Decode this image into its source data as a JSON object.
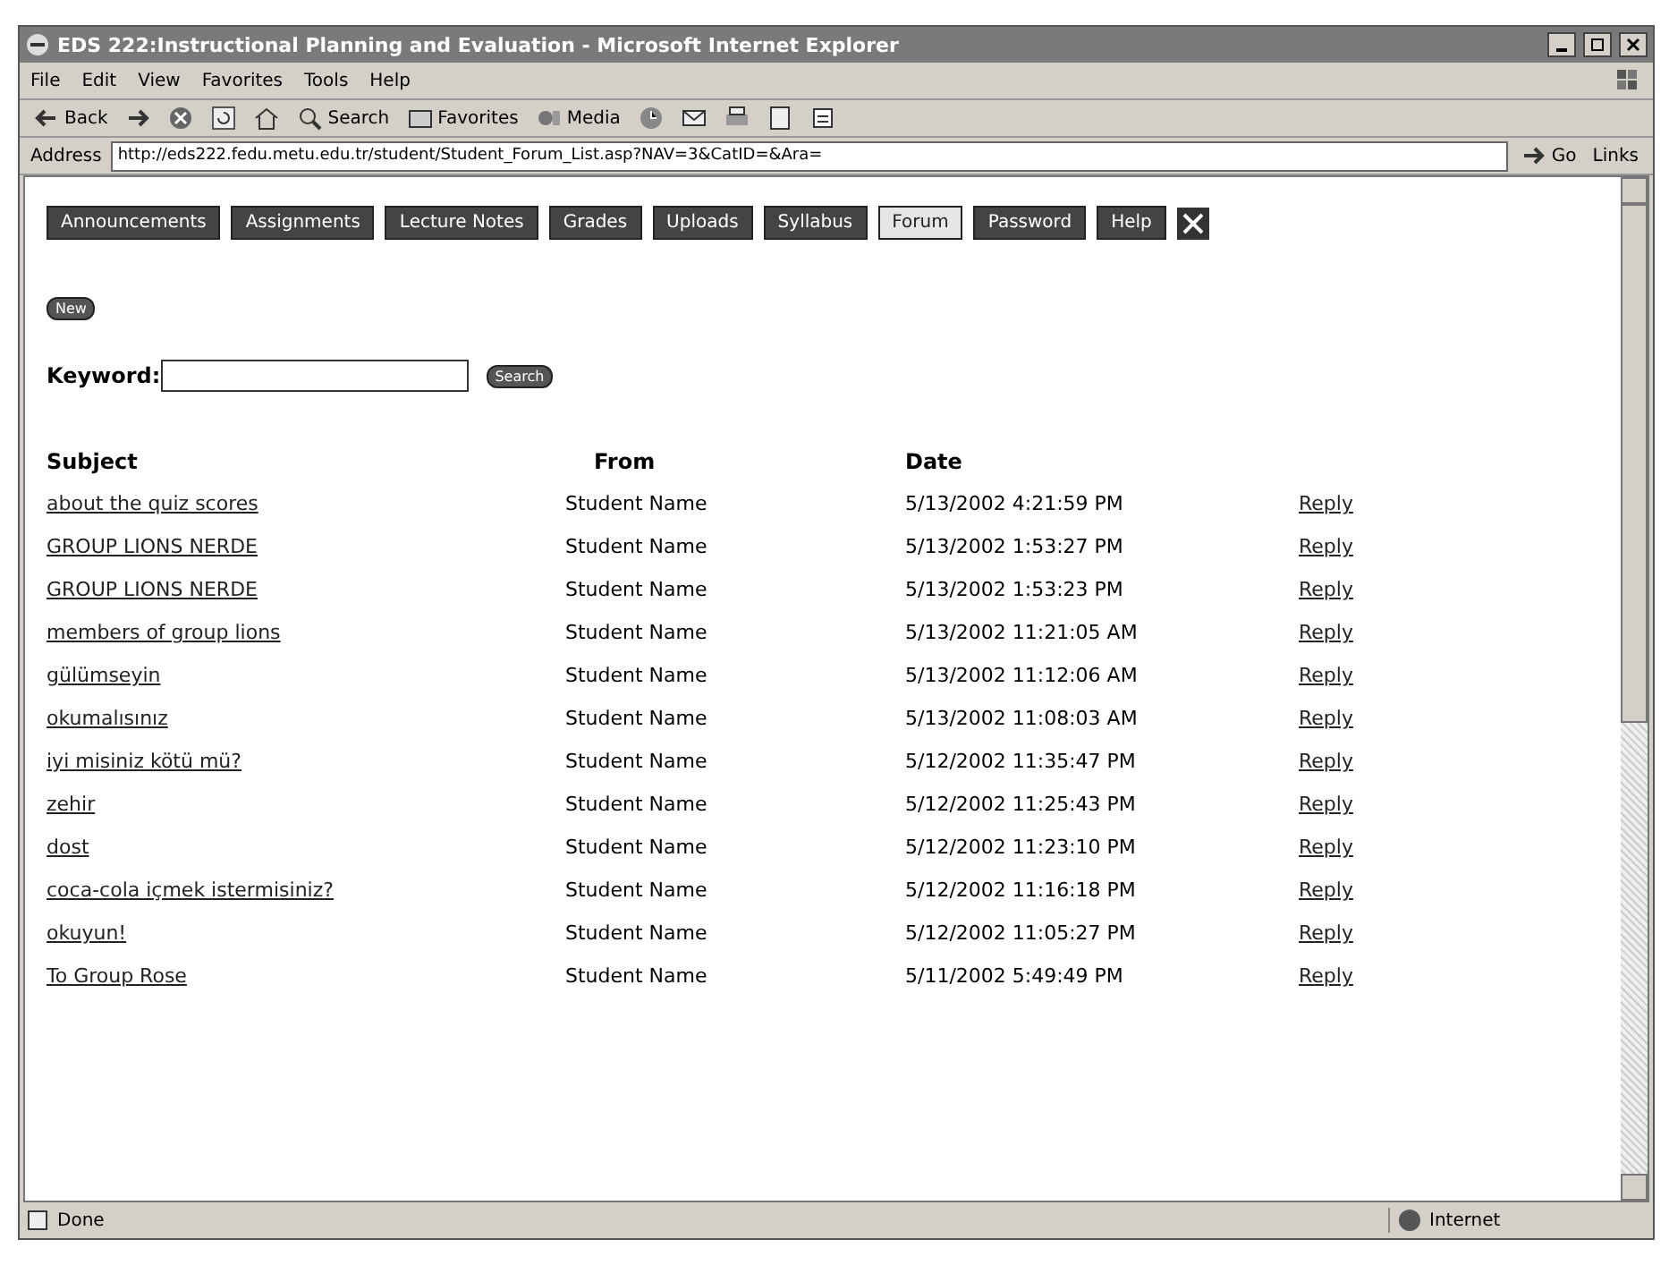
{
  "window": {
    "title": "EDS 222:Instructional Planning and Evaluation - Microsoft Internet Explorer"
  },
  "menu": [
    "File",
    "Edit",
    "View",
    "Favorites",
    "Tools",
    "Help"
  ],
  "toolbar": [
    {
      "kind": "back",
      "label": "Back"
    },
    {
      "kind": "forward"
    },
    {
      "kind": "stop"
    },
    {
      "kind": "refresh"
    },
    {
      "kind": "home"
    },
    {
      "kind": "search",
      "label": "Search"
    },
    {
      "kind": "favorites",
      "label": "Favorites"
    },
    {
      "kind": "media",
      "label": "Media"
    },
    {
      "kind": "history"
    },
    {
      "kind": "mail"
    },
    {
      "kind": "print"
    },
    {
      "kind": "edit"
    },
    {
      "kind": "discuss"
    }
  ],
  "address": {
    "label": "Address",
    "value": "http://eds222.fedu.metu.edu.tr/student/Student_Forum_List.asp?NAV=3&CatID=&Ara=",
    "go": "Go",
    "links": "Links"
  },
  "nav": [
    {
      "label": "Announcements",
      "selected": false
    },
    {
      "label": "Assignments",
      "selected": false
    },
    {
      "label": "Lecture Notes",
      "selected": false
    },
    {
      "label": "Grades",
      "selected": false
    },
    {
      "label": "Uploads",
      "selected": false
    },
    {
      "label": "Syllabus",
      "selected": false
    },
    {
      "label": "Forum",
      "selected": true
    },
    {
      "label": "Password",
      "selected": false
    },
    {
      "label": "Help",
      "selected": false
    }
  ],
  "new_button": "New",
  "search": {
    "label": "Keyword:",
    "button": "Search"
  },
  "table": {
    "columns": [
      "Subject",
      "From",
      "Date"
    ],
    "rows": [
      {
        "subject": "about the quiz scores",
        "from": "Student Name",
        "date": "5/13/2002 4:21:59 PM",
        "action": "Reply"
      },
      {
        "subject": "GROUP LIONS NERDE",
        "from": "Student Name",
        "date": "5/13/2002 1:53:27 PM",
        "action": "Reply"
      },
      {
        "subject": "GROUP LIONS NERDE",
        "from": "Student Name",
        "date": "5/13/2002 1:53:23 PM",
        "action": "Reply"
      },
      {
        "subject": "members of group lions",
        "from": "Student Name",
        "date": "5/13/2002 11:21:05 AM",
        "action": "Reply"
      },
      {
        "subject": "gülümseyin",
        "from": "Student Name",
        "date": "5/13/2002 11:12:06 AM",
        "action": "Reply"
      },
      {
        "subject": "okumalısınız",
        "from": "Student Name",
        "date": "5/13/2002 11:08:03 AM",
        "action": "Reply"
      },
      {
        "subject": "iyi misiniz kötü mü?",
        "from": "Student Name",
        "date": "5/12/2002 11:35:47 PM",
        "action": "Reply"
      },
      {
        "subject": "zehir",
        "from": "Student Name",
        "date": "5/12/2002 11:25:43 PM",
        "action": "Reply"
      },
      {
        "subject": "dost",
        "from": "Student Name",
        "date": "5/12/2002 11:23:10 PM",
        "action": "Reply"
      },
      {
        "subject": "coca-cola içmek istermisiniz?",
        "from": "Student Name",
        "date": "5/12/2002 11:16:18 PM",
        "action": "Reply"
      },
      {
        "subject": "okuyun!",
        "from": "Student Name",
        "date": "5/12/2002 11:05:27 PM",
        "action": "Reply"
      },
      {
        "subject": "To Group Rose",
        "from": "Student Name",
        "date": "5/11/2002 5:49:49 PM",
        "action": "Reply"
      }
    ]
  },
  "status_bar": {
    "text": "Done",
    "zone": "Internet"
  }
}
